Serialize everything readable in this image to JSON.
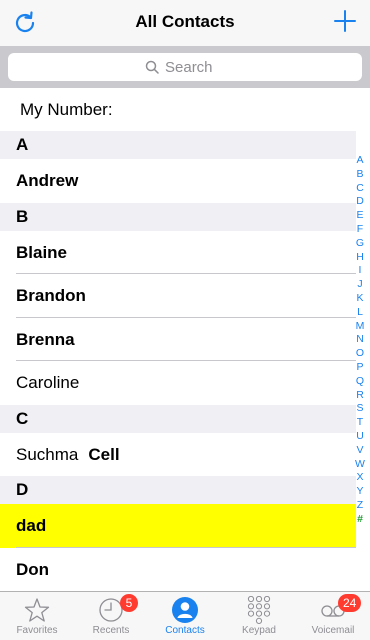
{
  "header": {
    "title": "All Contacts",
    "refresh_icon": "refresh-icon",
    "add_icon": "plus-icon",
    "accent_color": "#1a82ef"
  },
  "search": {
    "placeholder": "Search"
  },
  "my_number": {
    "label": "My Number:"
  },
  "sections": [
    {
      "letter": "A",
      "contacts": [
        {
          "name": "Andrew",
          "bold": true
        }
      ]
    },
    {
      "letter": "B",
      "contacts": [
        {
          "name": "Blaine",
          "bold": true
        },
        {
          "name": "Brandon",
          "bold": true
        },
        {
          "name": "Brenna",
          "bold": true
        },
        {
          "name": "Caroline",
          "bold": false
        }
      ]
    },
    {
      "letter": "C",
      "contacts": [
        {
          "name": "Suchma",
          "bold": false,
          "label": "Cell"
        }
      ]
    },
    {
      "letter": "D",
      "contacts": [
        {
          "name": "dad",
          "bold": true,
          "highlighted": true,
          "highlight_color": "#ffff00"
        },
        {
          "name": "Don",
          "bold": true
        }
      ]
    }
  ],
  "index_letters": [
    "A",
    "B",
    "C",
    "D",
    "E",
    "F",
    "G",
    "H",
    "I",
    "J",
    "K",
    "L",
    "M",
    "N",
    "O",
    "P",
    "Q",
    "R",
    "S",
    "T",
    "U",
    "V",
    "W",
    "X",
    "Y",
    "Z",
    "#"
  ],
  "tabs": [
    {
      "label": "Favorites",
      "icon": "star-icon",
      "active": false
    },
    {
      "label": "Recents",
      "icon": "clock-icon",
      "active": false,
      "badge": "5"
    },
    {
      "label": "Contacts",
      "icon": "person-circle-icon",
      "active": true
    },
    {
      "label": "Keypad",
      "icon": "keypad-icon",
      "active": false
    },
    {
      "label": "Voicemail",
      "icon": "voicemail-icon",
      "active": false,
      "badge": "24"
    }
  ]
}
